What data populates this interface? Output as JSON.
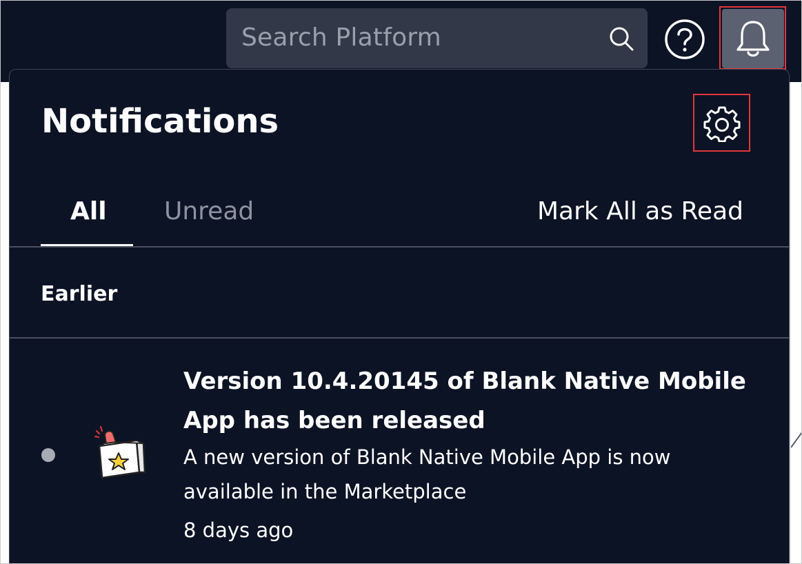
{
  "header": {
    "search": {
      "placeholder": "Search Platform",
      "icon": "search-icon"
    },
    "help": {
      "icon": "question-circle-icon"
    },
    "notifications": {
      "icon": "bell-icon"
    }
  },
  "notifications_panel": {
    "title": "Notifications",
    "settings_icon": "gear-icon",
    "tabs": [
      {
        "label": "All",
        "selected": true
      },
      {
        "label": "Unread",
        "selected": false
      }
    ],
    "mark_all_label": "Mark All as Read",
    "section_label": "Earlier",
    "items": [
      {
        "unread": true,
        "icon": "release-box-icon",
        "title": "Version 10.4.20145 of Blank Native Mobile App has been released",
        "body": "A new version of Blank Native Mobile App is now available in the Marketplace",
        "time": "8 days ago"
      }
    ]
  },
  "colors": {
    "background": "#0c1324",
    "search_bg": "#323847",
    "active_button_bg": "#5b6170",
    "highlight": "#e4373a",
    "muted_text": "#8d93a0"
  }
}
